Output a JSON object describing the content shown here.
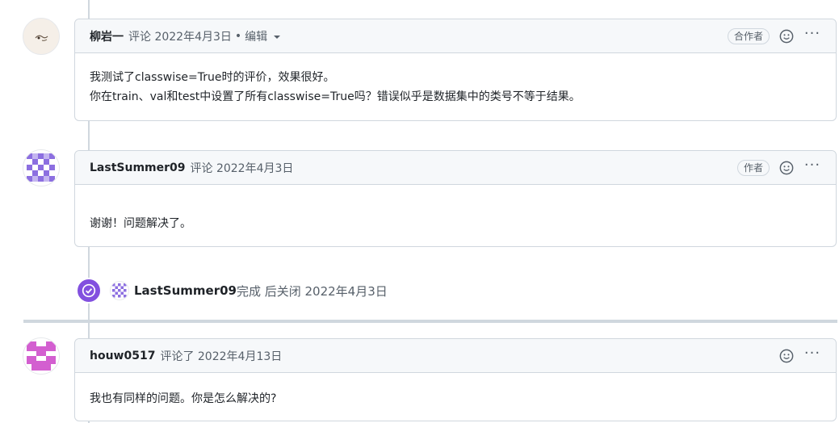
{
  "comments": [
    {
      "author": "柳岩一",
      "meta": "评论 2022年4月3日",
      "sep": "•",
      "edit_label": "编辑",
      "badge": "合作者",
      "body": [
        "我测试了classwise=True时的评价，效果很好。",
        "你在train、val和test中设置了所有classwise=True吗？错误似乎是数据集中的类号不等于结果。"
      ]
    },
    {
      "author": "LastSummer09",
      "meta": "评论 2022年4月3日",
      "badge": "作者",
      "body": [
        "谢谢！问题解决了。"
      ]
    },
    {
      "author": "houw0517",
      "meta": "评论了 2022年4月13日",
      "body": [
        "我也有同样的问题。你是怎么解决的?"
      ]
    }
  ],
  "event": {
    "author": "LastSummer09",
    "action": "完成 后关闭 2022年4月3日",
    "icon": "check-circle-icon",
    "accent": "#8250df"
  },
  "icons": {
    "reaction": "smiley-icon",
    "menu": "kebab-icon"
  }
}
